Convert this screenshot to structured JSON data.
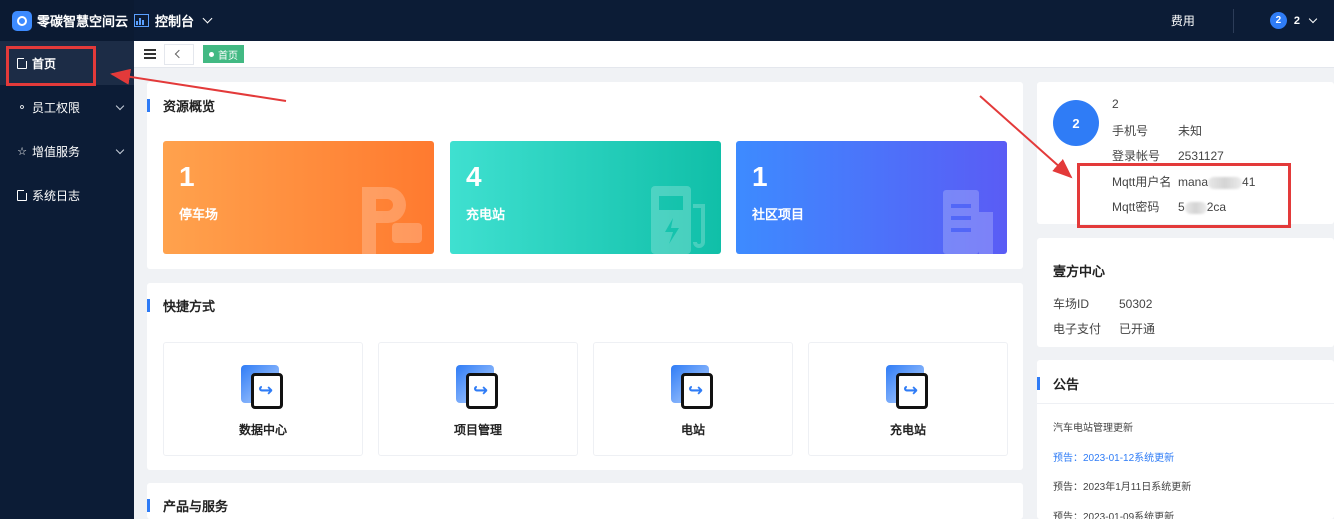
{
  "app": {
    "logo_text": "零碳智慧空间云",
    "console_label": "控制台",
    "fee_label": "费用",
    "user_badge": "2",
    "user_name": "2"
  },
  "sidebar": {
    "items": [
      {
        "label": "首页",
        "icon": "document-icon",
        "active": true
      },
      {
        "label": "员工权限",
        "icon": "user-key-icon",
        "expandable": true
      },
      {
        "label": "增值服务",
        "icon": "star-icon",
        "expandable": true
      },
      {
        "label": "系统日志",
        "icon": "document-icon"
      }
    ]
  },
  "tabs": {
    "active_tag": "首页"
  },
  "overview": {
    "title": "资源概览",
    "cards": [
      {
        "count": "1",
        "label": "停车场",
        "icon": "parking-icon",
        "color": "#ff8a3d"
      },
      {
        "count": "4",
        "label": "充电站",
        "icon": "charging-pile-icon",
        "color": "#1fcdb8"
      },
      {
        "count": "1",
        "label": "社区项目",
        "icon": "building-icon",
        "color": "#4a74fb"
      }
    ]
  },
  "shortcuts": {
    "title": "快捷方式",
    "items": [
      {
        "label": "数据中心",
        "icon": "shortcut-arrow-icon"
      },
      {
        "label": "项目管理",
        "icon": "shortcut-arrow-icon"
      },
      {
        "label": "电站",
        "icon": "shortcut-arrow-icon"
      },
      {
        "label": "充电站",
        "icon": "shortcut-arrow-icon"
      }
    ]
  },
  "products": {
    "title": "产品与服务"
  },
  "profile": {
    "avatar_text": "2",
    "name": "2",
    "fields": [
      {
        "key": "手机号",
        "value": "未知"
      },
      {
        "key": "登录帐号",
        "value": "2531127"
      },
      {
        "key": "Mqtt用户名",
        "value_prefix": "mana",
        "value_suffix": "41"
      },
      {
        "key": "Mqtt密码",
        "value_prefix": "5",
        "value_suffix": "2ca"
      }
    ]
  },
  "center": {
    "title": "壹方中心",
    "fields": [
      {
        "key": "车场ID",
        "value": "50302"
      },
      {
        "key": "电子支付",
        "value": "已开通"
      }
    ]
  },
  "announcements": {
    "title": "公告",
    "items": [
      {
        "text": "汽车电站管理更新",
        "highlight": false
      },
      {
        "text": "预告：2023-01-12系统更新",
        "highlight": true
      },
      {
        "text": "预告：2023年1月11日系统更新",
        "highlight": false
      },
      {
        "text": "预告：2023-01-09系统更新",
        "highlight": false
      }
    ]
  },
  "colors": {
    "nav_bg": "#0c1c36",
    "accent": "#2f7cf6",
    "tag_green": "#42b983",
    "annotation_red": "#e33a3a"
  }
}
